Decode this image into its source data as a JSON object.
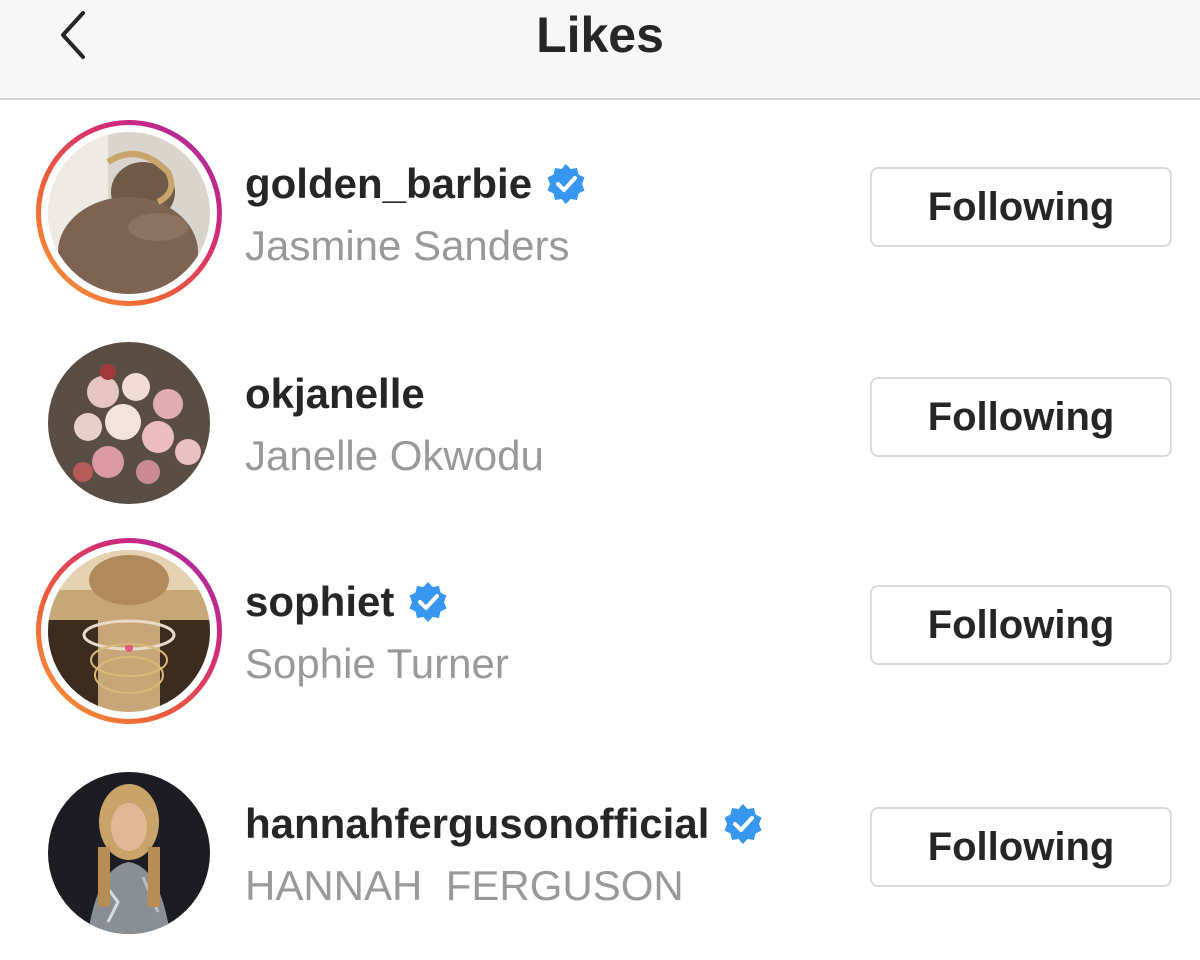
{
  "header": {
    "title": "Likes",
    "back_icon": "chevron-left-icon"
  },
  "colors": {
    "verified_blue": "#3897f0",
    "story_ring_start": "#f9a13a",
    "story_ring_end": "#9a2eb1",
    "secondary_text": "#999999",
    "primary_text": "#262626"
  },
  "likes": [
    {
      "username": "golden_barbie",
      "full_name": "Jasmine Sanders",
      "verified": true,
      "story_ring": true,
      "button_label": "Following"
    },
    {
      "username": "okjanelle",
      "full_name": "Janelle Okwodu",
      "verified": false,
      "story_ring": false,
      "button_label": "Following"
    },
    {
      "username": "sophiet",
      "full_name": "Sophie Turner",
      "verified": true,
      "story_ring": true,
      "button_label": "Following"
    },
    {
      "username": "hannahfergusonofficial",
      "full_name": "HANNAH  FERGUSON",
      "verified": true,
      "story_ring": false,
      "button_label": "Following"
    }
  ]
}
